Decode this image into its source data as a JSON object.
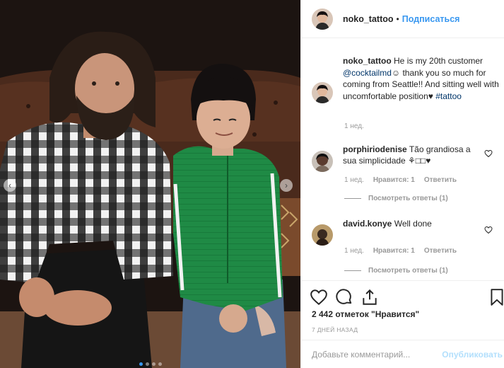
{
  "post": {
    "username": "noko_tattoo",
    "separator": "•",
    "follow_label": "Подписаться"
  },
  "caption": {
    "username": "noko_tattoo",
    "text_before": "He is my 20th customer",
    "mention": "@cocktailmd",
    "text_after": "☺ thank you so much for coming from Seattle!! And sitting well with uncomfortable position♥",
    "hashtag": "#tattoo",
    "time": "1 нед."
  },
  "comments": [
    {
      "username": "porphiriodenise",
      "text": "Tão grandiosa a sua simplicidade ⚘□□♥",
      "time": "1 нед.",
      "likes": "Нравится: 1",
      "reply": "Ответить",
      "view_replies": "Посмотреть ответы (1)"
    },
    {
      "username": "david.konye",
      "text": "Well done",
      "time": "1 нед.",
      "likes": "Нравится: 1",
      "reply": "Ответить",
      "view_replies": "Посмотреть ответы (1)"
    }
  ],
  "stats": {
    "likes_text": "2 442 отметок \"Нравится\"",
    "time_ago": "7 ДНЕЙ НАЗАД"
  },
  "add_comment": {
    "placeholder": "Добавьте комментарий...",
    "publish_label": "Опубликовать"
  },
  "icons": {
    "like": "heart-icon",
    "comment": "comment-bubble-icon",
    "share": "share-icon",
    "save": "bookmark-icon",
    "prev": "chevron-left-icon",
    "next": "chevron-right-icon"
  },
  "colors": {
    "link_blue": "#3897f0",
    "publish_disabled": "#b2dffc",
    "meta_gray": "#999999"
  },
  "carousel": {
    "count": 4,
    "active_index": 0
  }
}
